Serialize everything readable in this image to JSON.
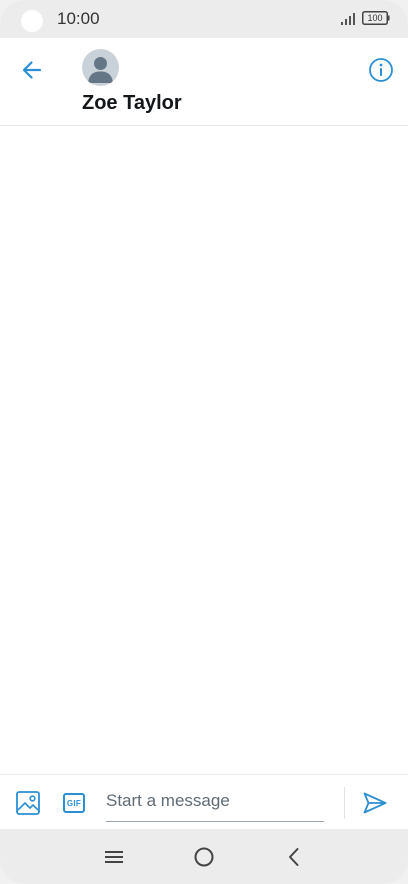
{
  "status_bar": {
    "time": "10:00",
    "battery_level": "100",
    "signal_icon": "signal-bars-icon",
    "battery_icon": "battery-icon"
  },
  "header": {
    "contact_name": "Zoe Taylor",
    "back_icon": "arrow-left-icon",
    "avatar_icon": "default-avatar-icon",
    "info_icon": "info-circle-icon"
  },
  "composer": {
    "placeholder": "Start a message",
    "value": "",
    "media_icon": "image-icon",
    "gif_label": "GIF",
    "send_icon": "send-icon"
  },
  "nav_bar": {
    "menu_icon": "recent-apps-icon",
    "home_icon": "home-circle-icon",
    "back_icon": "chevron-left-icon"
  },
  "colors": {
    "accent": "#2b8fd3",
    "status_bar_bg": "#ececec",
    "nav_bar_bg": "#ececec",
    "avatar_bg": "#c9d1d9",
    "avatar_fg": "#657786",
    "text_primary": "#14171a"
  }
}
